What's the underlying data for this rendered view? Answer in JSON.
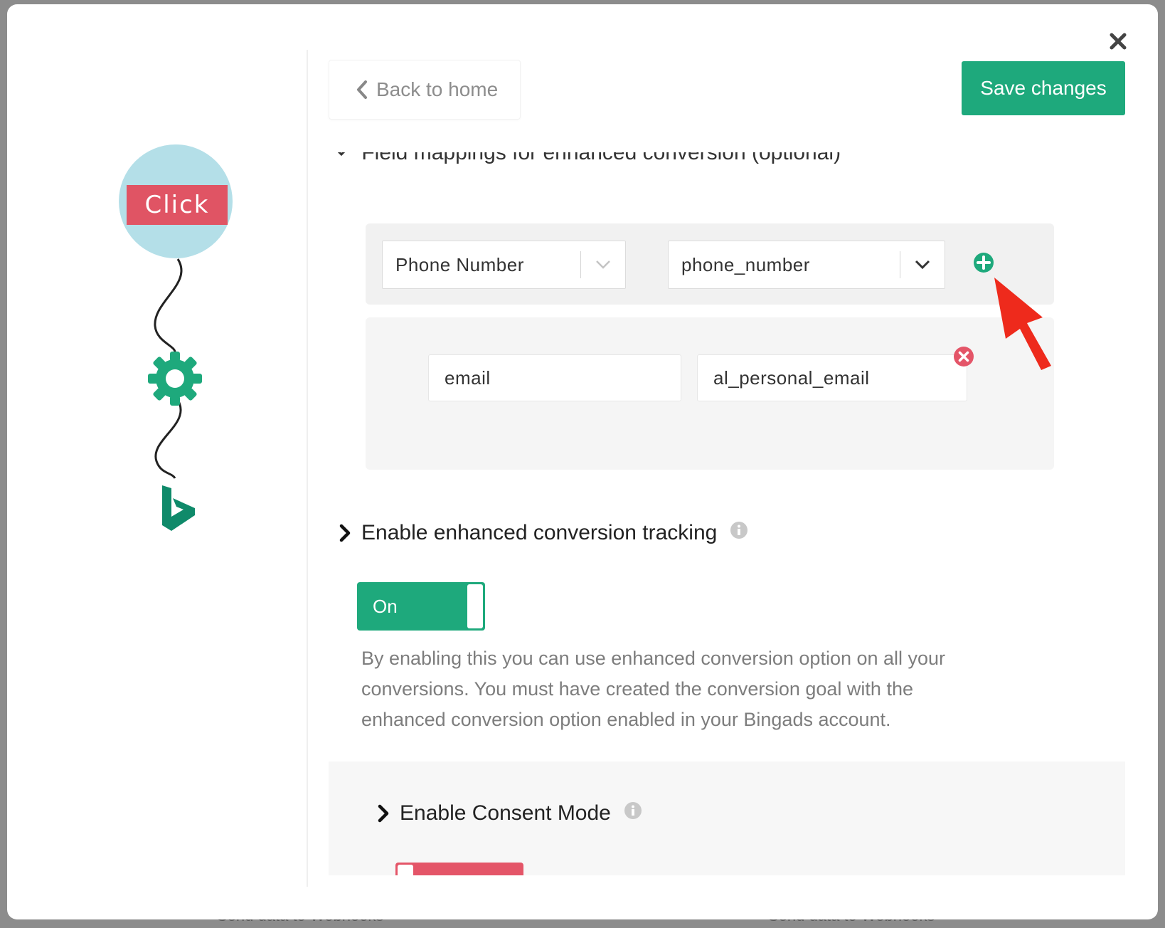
{
  "backdrop": {
    "left_text": "Send data to Webhooks",
    "right_text": "Send data to Webhooks"
  },
  "flow": {
    "trigger_label": "Click"
  },
  "header": {
    "back_label": "Back to home",
    "save_label": "Save changes"
  },
  "field_mapping": {
    "heading": "Field mappings for enhanced conversion (optional)",
    "rows": [
      {
        "source": "Phone Number",
        "target": "phone_number"
      },
      {
        "source": "email",
        "target": "al_personal_email"
      }
    ]
  },
  "enhanced_tracking": {
    "label": "Enable enhanced conversion tracking",
    "toggle_label": "On",
    "toggle_state": "on",
    "description": "By enabling this you can use enhanced conversion option on all your conversions. You must have created the conversion goal with the enhanced conversion option enabled in your Bingads account."
  },
  "consent_mode": {
    "label": "Enable Consent Mode",
    "toggle_state": "off"
  },
  "colors": {
    "accent": "#1ea97c",
    "danger": "#e45568",
    "annotation_arrow": "#ee2a1c"
  }
}
